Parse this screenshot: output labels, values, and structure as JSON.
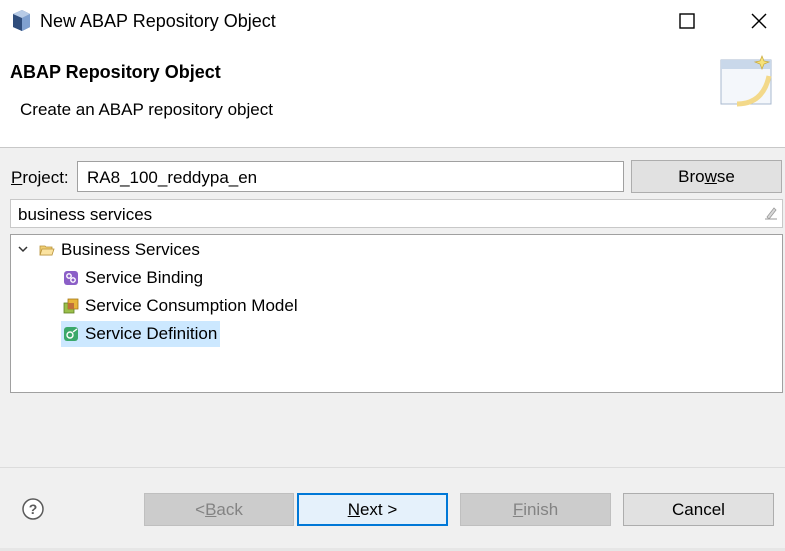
{
  "window": {
    "title": "New ABAP Repository Object",
    "icon": "abap-cube-icon",
    "controls": [
      "minimize",
      "maximize-icon",
      "close-icon"
    ]
  },
  "header": {
    "title": "ABAP Repository Object",
    "description": "Create an ABAP repository object",
    "banner_icon": "wizard-banner-icon"
  },
  "project": {
    "label_underlined": "P",
    "label_rest": "roject:",
    "value": "RA8_100_reddypa_en",
    "browse_pre": "Bro",
    "browse_underlined": "w",
    "browse_post": "se"
  },
  "filter": {
    "value": "business services",
    "clear_icon": "clear-filter-icon"
  },
  "tree": {
    "folder": {
      "label": "Business Services",
      "expanded": true,
      "icon": "folder-open-icon"
    },
    "items": [
      {
        "label": "Service Binding",
        "icon": "service-binding-icon",
        "selected": false
      },
      {
        "label": "Service Consumption Model",
        "icon": "service-consumption-model-icon",
        "selected": false
      },
      {
        "label": "Service Definition",
        "icon": "service-definition-icon",
        "selected": true
      }
    ]
  },
  "buttons": {
    "help_icon": "help-icon",
    "back": {
      "pre": "< ",
      "underlined": "B",
      "post": "ack",
      "enabled": false
    },
    "next": {
      "underlined": "N",
      "post": "ext >",
      "enabled": true
    },
    "finish": {
      "underlined": "F",
      "post": "inish",
      "enabled": false
    },
    "cancel": {
      "label": "Cancel",
      "enabled": true
    }
  },
  "colors": {
    "selection": "#cce8ff",
    "default_button_border": "#0078d7"
  }
}
